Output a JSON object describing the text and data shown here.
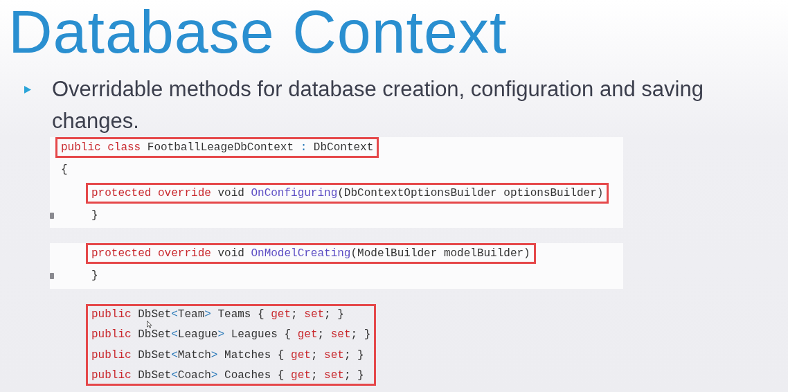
{
  "slide": {
    "title": "Database Context",
    "bullets": [
      {
        "text": "Overridable methods for database creation, configuration and saving changes."
      }
    ],
    "code_panels": [
      {
        "shaded": true,
        "blocks": [
          {
            "kind": "top",
            "highlighted": true,
            "lines": [
              {
                "fold_marker": false,
                "tokens": [
                  {
                    "kind": "kw",
                    "text": "public class"
                  },
                  {
                    "kind": "plain",
                    "text": " FootballLeageDbContext "
                  },
                  {
                    "kind": "type",
                    "text": ":"
                  },
                  {
                    "kind": "plain",
                    "text": " DbContext"
                  }
                ]
              }
            ]
          },
          {
            "kind": "top",
            "highlighted": false,
            "lines": [
              {
                "fold_marker": false,
                "tokens": [
                  {
                    "kind": "plain",
                    "text": "{"
                  }
                ]
              }
            ]
          },
          {
            "kind": "inner",
            "highlighted": true,
            "lines": [
              {
                "fold_marker": false,
                "tokens": [
                  {
                    "kind": "kw",
                    "text": "protected override"
                  },
                  {
                    "kind": "plain",
                    "text": " void "
                  },
                  {
                    "kind": "method",
                    "text": "OnConfiguring"
                  },
                  {
                    "kind": "plain",
                    "text": "(DbContextOptionsBuilder optionsBuilder)"
                  }
                ]
              }
            ]
          },
          {
            "kind": "inner",
            "highlighted": false,
            "lines": [
              {
                "fold_marker": true,
                "tokens": [
                  {
                    "kind": "plain",
                    "text": "}"
                  }
                ]
              }
            ]
          }
        ]
      },
      {
        "shaded": true,
        "blocks": [
          {
            "kind": "inner",
            "highlighted": true,
            "lines": [
              {
                "fold_marker": false,
                "tokens": [
                  {
                    "kind": "kw",
                    "text": "protected override"
                  },
                  {
                    "kind": "plain",
                    "text": " void "
                  },
                  {
                    "kind": "method",
                    "text": "OnModelCreating"
                  },
                  {
                    "kind": "plain",
                    "text": "(ModelBuilder modelBuilder)"
                  }
                ]
              }
            ]
          },
          {
            "kind": "inner",
            "highlighted": false,
            "lines": [
              {
                "fold_marker": true,
                "tokens": [
                  {
                    "kind": "plain",
                    "text": "}"
                  }
                ]
              }
            ]
          }
        ]
      },
      {
        "shaded": false,
        "blocks": [
          {
            "kind": "inner",
            "highlighted": true,
            "lines": [
              {
                "fold_marker": false,
                "tokens": [
                  {
                    "kind": "kw",
                    "text": "public"
                  },
                  {
                    "kind": "plain",
                    "text": " DbSet"
                  },
                  {
                    "kind": "type",
                    "text": "<"
                  },
                  {
                    "kind": "plain",
                    "text": "Team"
                  },
                  {
                    "kind": "type",
                    "text": ">"
                  },
                  {
                    "kind": "plain",
                    "text": " Teams { "
                  },
                  {
                    "kind": "kw",
                    "text": "get"
                  },
                  {
                    "kind": "plain",
                    "text": "; "
                  },
                  {
                    "kind": "kw",
                    "text": "set"
                  },
                  {
                    "kind": "plain",
                    "text": "; }"
                  }
                ]
              },
              {
                "fold_marker": false,
                "tokens": [
                  {
                    "kind": "kw",
                    "text": "public"
                  },
                  {
                    "kind": "plain",
                    "text": " DbSet"
                  },
                  {
                    "kind": "type",
                    "text": "<"
                  },
                  {
                    "kind": "plain",
                    "text": "League"
                  },
                  {
                    "kind": "type",
                    "text": ">"
                  },
                  {
                    "kind": "plain",
                    "text": " Leagues { "
                  },
                  {
                    "kind": "kw",
                    "text": "get"
                  },
                  {
                    "kind": "plain",
                    "text": "; "
                  },
                  {
                    "kind": "kw",
                    "text": "set"
                  },
                  {
                    "kind": "plain",
                    "text": "; }"
                  }
                ]
              },
              {
                "fold_marker": false,
                "tokens": [
                  {
                    "kind": "kw",
                    "text": "public"
                  },
                  {
                    "kind": "plain",
                    "text": " DbSet"
                  },
                  {
                    "kind": "type",
                    "text": "<"
                  },
                  {
                    "kind": "plain",
                    "text": "Match"
                  },
                  {
                    "kind": "type",
                    "text": ">"
                  },
                  {
                    "kind": "plain",
                    "text": " Matches { "
                  },
                  {
                    "kind": "kw",
                    "text": "get"
                  },
                  {
                    "kind": "plain",
                    "text": "; "
                  },
                  {
                    "kind": "kw",
                    "text": "set"
                  },
                  {
                    "kind": "plain",
                    "text": "; }"
                  }
                ]
              },
              {
                "fold_marker": false,
                "tokens": [
                  {
                    "kind": "kw",
                    "text": "public"
                  },
                  {
                    "kind": "plain",
                    "text": " DbSet"
                  },
                  {
                    "kind": "type",
                    "text": "<"
                  },
                  {
                    "kind": "plain",
                    "text": "Coach"
                  },
                  {
                    "kind": "type",
                    "text": ">"
                  },
                  {
                    "kind": "plain",
                    "text": " Coaches { "
                  },
                  {
                    "kind": "kw",
                    "text": "get"
                  },
                  {
                    "kind": "plain",
                    "text": "; "
                  },
                  {
                    "kind": "kw",
                    "text": "set"
                  },
                  {
                    "kind": "plain",
                    "text": "; }"
                  }
                ]
              }
            ]
          }
        ]
      }
    ]
  }
}
